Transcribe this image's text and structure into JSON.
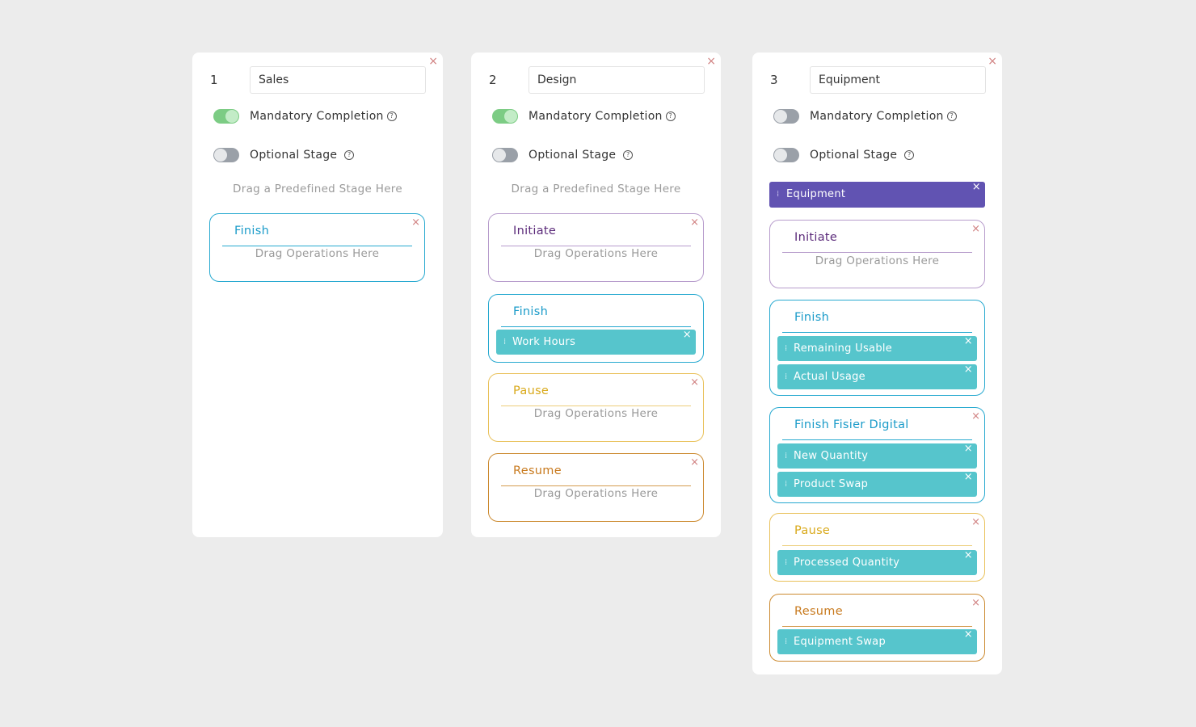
{
  "close_glyph": "×",
  "help_glyph": "?",
  "grip_glyph": "⁞",
  "drag_stage_hint": "Drag a Predefined Stage Here",
  "drag_ops_hint": "Drag Operations Here",
  "colors": {
    "toggle_on": "#7ccc84",
    "toggle_off": "#9aa0a8",
    "chip": "#56c5cc",
    "stage_banner": "#6153b2",
    "initiate": "#b79ccc",
    "finish": "#27a9d0",
    "pause": "#e9c15a",
    "resume": "#cc8a30"
  },
  "cards": [
    {
      "number": "1",
      "name": "Sales",
      "mandatory_label": "Mandatory Completion",
      "mandatory_on": true,
      "optional_label": "Optional Stage",
      "optional_on": false,
      "operations": [
        {
          "title": "Finish",
          "color": "cyan",
          "chips": []
        }
      ]
    },
    {
      "number": "2",
      "name": "Design",
      "mandatory_label": "Mandatory Completion",
      "mandatory_on": true,
      "optional_label": "Optional Stage",
      "optional_on": false,
      "operations": [
        {
          "title": "Initiate",
          "color": "purple",
          "chips": []
        },
        {
          "title": "Finish",
          "color": "cyan",
          "chips": [
            "Work Hours"
          ]
        },
        {
          "title": "Pause",
          "color": "yellow",
          "chips": []
        },
        {
          "title": "Resume",
          "color": "orange",
          "chips": []
        }
      ]
    },
    {
      "number": "3",
      "name": "Equipment",
      "mandatory_label": "Mandatory Completion",
      "mandatory_on": false,
      "optional_label": "Optional Stage",
      "optional_on": false,
      "predefined_stage": "Equipment",
      "operations": [
        {
          "title": "Initiate",
          "color": "purple",
          "chips": []
        },
        {
          "title": "Finish",
          "color": "cyan",
          "chips": [
            "Remaining Usable",
            "Actual Usage"
          ]
        },
        {
          "title": "Finish Fisier Digital",
          "color": "cyan",
          "chips": [
            "New Quantity",
            "Product Swap"
          ]
        },
        {
          "title": "Pause",
          "color": "yellow",
          "chips": [
            "Processed Quantity"
          ]
        },
        {
          "title": "Resume",
          "color": "orange",
          "chips": [
            "Equipment Swap"
          ]
        }
      ]
    }
  ]
}
